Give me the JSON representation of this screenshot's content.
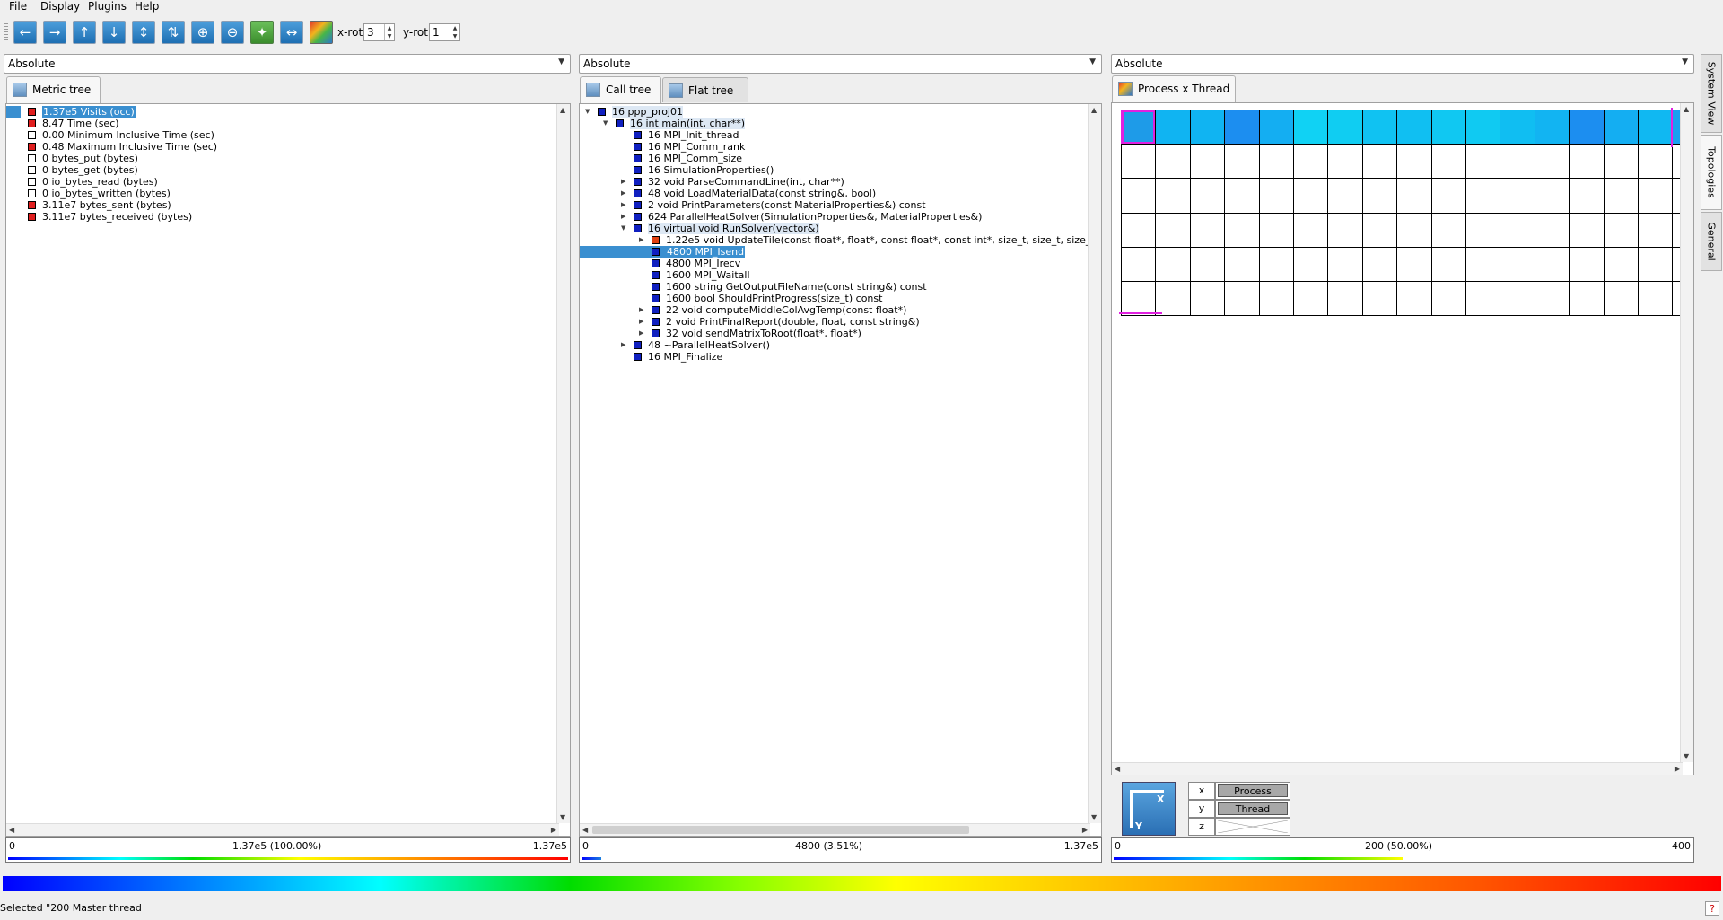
{
  "menubar": {
    "file": "File",
    "display": "Display",
    "plugins": "Plugins",
    "help": "Help"
  },
  "toolbar": {
    "icons": [
      "arrow-left-icon",
      "arrow-right-icon",
      "arrow-up-icon",
      "arrow-down-icon",
      "expand-vertical-icon",
      "expand-all-icon",
      "zoom-in-icon",
      "zoom-out-icon",
      "center-icon",
      "fit-horizontal-icon",
      "color-scale-icon"
    ],
    "x_rot_label": "x-rot:",
    "x_rot_value": "3",
    "y_rot_label": "y-rot:",
    "y_rot_value": "1"
  },
  "metric_panel": {
    "mode": "Absolute",
    "tab": "Metric tree",
    "items": [
      {
        "label": "1.37e5 Visits (occ)",
        "color": "#e01e1e",
        "selected": true
      },
      {
        "label": "8.47 Time (sec)",
        "color": "#e01e1e"
      },
      {
        "label": "0.00 Minimum Inclusive Time (sec)",
        "color": "#ffffff"
      },
      {
        "label": "0.48 Maximum Inclusive Time (sec)",
        "color": "#e01e1e"
      },
      {
        "label": "0 bytes_put (bytes)",
        "color": "#ffffff"
      },
      {
        "label": "0 bytes_get (bytes)",
        "color": "#ffffff"
      },
      {
        "label": "0 io_bytes_read (bytes)",
        "color": "#ffffff"
      },
      {
        "label": "0 io_bytes_written (bytes)",
        "color": "#ffffff"
      },
      {
        "label": "3.11e7 bytes_sent (bytes)",
        "color": "#e01e1e"
      },
      {
        "label": "3.11e7 bytes_received (bytes)",
        "color": "#e01e1e"
      }
    ],
    "bar_min": "0",
    "bar_value": "1.37e5 (100.00%)",
    "bar_max": "1.37e5"
  },
  "call_panel": {
    "mode": "Absolute",
    "tabs": [
      "Call tree",
      "Flat tree"
    ],
    "items": [
      {
        "label": "16 ppp_proj01",
        "depth": 0,
        "expanded": true,
        "color": "#1020c0",
        "hl": true
      },
      {
        "label": "16 int main(int, char**)",
        "depth": 1,
        "expanded": true,
        "color": "#1020c0",
        "hl": true
      },
      {
        "label": "16 MPI_Init_thread",
        "depth": 2,
        "color": "#1020c0"
      },
      {
        "label": "16 MPI_Comm_rank",
        "depth": 2,
        "color": "#1020c0"
      },
      {
        "label": "16 MPI_Comm_size",
        "depth": 2,
        "color": "#1020c0"
      },
      {
        "label": "16 SimulationProperties()",
        "depth": 2,
        "color": "#1020c0"
      },
      {
        "label": "32 void ParseCommandLine(int, char**)",
        "depth": 2,
        "collapsed": true,
        "color": "#1020c0"
      },
      {
        "label": "48 void LoadMaterialData(const string&, bool)",
        "depth": 2,
        "collapsed": true,
        "color": "#1020c0"
      },
      {
        "label": "2 void PrintParameters(const MaterialProperties&) const",
        "depth": 2,
        "collapsed": true,
        "color": "#1020c0"
      },
      {
        "label": "624 ParallelHeatSolver(SimulationProperties&, MaterialProperties&)",
        "depth": 2,
        "collapsed": true,
        "color": "#1020c0"
      },
      {
        "label": "16 virtual void RunSolver(vector&)",
        "depth": 2,
        "expanded": true,
        "color": "#1020c0",
        "hl": true
      },
      {
        "label": "1.22e5 void UpdateTile(const float*, float*, const float*, const int*, size_t, size_t, size_t, s",
        "depth": 3,
        "collapsed": true,
        "color": "#e04010"
      },
      {
        "label": "4800 MPI_Isend",
        "depth": 3,
        "color": "#1020c0",
        "selected": true
      },
      {
        "label": "4800 MPI_Irecv",
        "depth": 3,
        "color": "#1020c0"
      },
      {
        "label": "1600 MPI_Waitall",
        "depth": 3,
        "color": "#1020c0"
      },
      {
        "label": "1600 string GetOutputFileName(const string&) const",
        "depth": 3,
        "color": "#1020c0"
      },
      {
        "label": "1600 bool ShouldPrintProgress(size_t) const",
        "depth": 3,
        "color": "#1020c0"
      },
      {
        "label": "22 void computeMiddleColAvgTemp(const float*)",
        "depth": 3,
        "collapsed": true,
        "color": "#1020c0"
      },
      {
        "label": "2 void PrintFinalReport(double, float, const string&)",
        "depth": 3,
        "collapsed": true,
        "color": "#1020c0"
      },
      {
        "label": "32 void sendMatrixToRoot(float*, float*)",
        "depth": 3,
        "collapsed": true,
        "color": "#1020c0"
      },
      {
        "label": "48 ~ParallelHeatSolver()",
        "depth": 2,
        "collapsed": true,
        "color": "#1020c0"
      },
      {
        "label": "16 MPI_Finalize",
        "depth": 2,
        "color": "#1020c0"
      }
    ],
    "bar_min": "0",
    "bar_value": "4800 (3.51%)",
    "bar_max": "1.37e5"
  },
  "topo_panel": {
    "mode": "Absolute",
    "tab": "Process x Thread",
    "row1_colors": [
      "#1e9be8",
      "#10b4f2",
      "#10b4f2",
      "#1c8ef0",
      "#14aef2",
      "#10d2f4",
      "#10cdf2",
      "#10c2f2",
      "#10bff2",
      "#10c8f2",
      "#10caf2",
      "#10bef2",
      "#12b4f2",
      "#1c8ef0",
      "#14aef2",
      "#10b8f2",
      "#18a0f0"
    ],
    "axis_x": "X",
    "axis_y": "Y",
    "dims": [
      {
        "axis": "x",
        "value": "Process"
      },
      {
        "axis": "y",
        "value": "Thread"
      },
      {
        "axis": "z",
        "value": ""
      }
    ],
    "bar_min": "0",
    "bar_value": "200 (50.00%)",
    "bar_max": "400"
  },
  "side_tabs": [
    "System View",
    "Topologies",
    "General"
  ],
  "status": "Selected \"200 Master thread"
}
